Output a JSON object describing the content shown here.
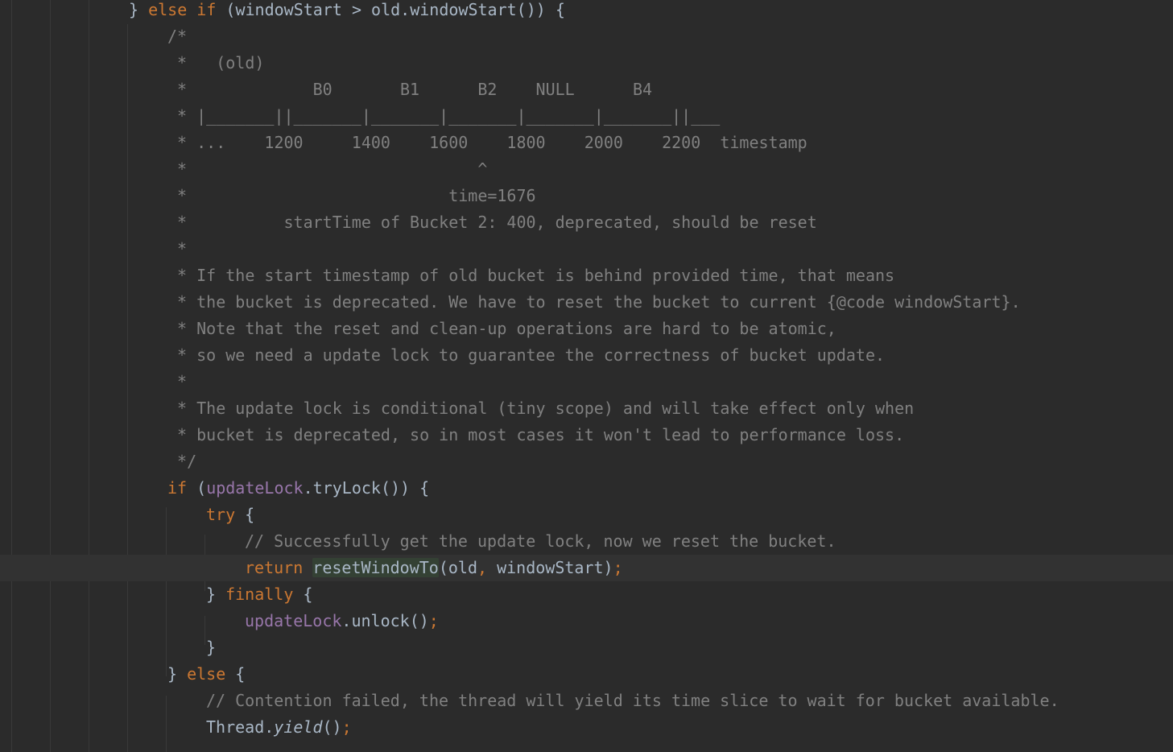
{
  "editor": {
    "line_height": 33,
    "colors": {
      "background": "#2b2b2b",
      "keyword": "#cc7832",
      "comment": "#808080",
      "field": "#9876aa",
      "text": "#a9b7c6",
      "current_line": "#323232",
      "identifier_highlight": "#344134"
    },
    "lines": [
      {
        "indent": 160,
        "tokens": [
          {
            "t": "} ",
            "c": "plain"
          },
          {
            "t": "else if",
            "c": "kw"
          },
          {
            "t": " (windowStart > old.windowStart()) {",
            "c": "plain"
          }
        ]
      },
      {
        "indent": 208,
        "tokens": [
          {
            "t": "/*",
            "c": "cm"
          }
        ]
      },
      {
        "indent": 208,
        "tokens": [
          {
            "t": " *   (old)",
            "c": "cm"
          }
        ]
      },
      {
        "indent": 208,
        "tokens": [
          {
            "t": " *             B0       B1      B2    NULL      B4",
            "c": "cm"
          }
        ]
      },
      {
        "indent": 208,
        "tokens": [
          {
            "t": " * |_______||_______|_______|_______|_______|_______||___",
            "c": "cm"
          }
        ]
      },
      {
        "indent": 208,
        "tokens": [
          {
            "t": " * ...    1200     1400    1600    1800    2000    2200  timestamp",
            "c": "cm"
          }
        ]
      },
      {
        "indent": 208,
        "tokens": [
          {
            "t": " *                              ^",
            "c": "cm"
          }
        ]
      },
      {
        "indent": 208,
        "tokens": [
          {
            "t": " *                           time=1676",
            "c": "cm"
          }
        ]
      },
      {
        "indent": 208,
        "tokens": [
          {
            "t": " *          startTime of Bucket 2: 400, deprecated, should be reset",
            "c": "cm"
          }
        ]
      },
      {
        "indent": 208,
        "tokens": [
          {
            "t": " *",
            "c": "cm"
          }
        ]
      },
      {
        "indent": 208,
        "tokens": [
          {
            "t": " * If the start timestamp of old bucket is behind provided time, that means",
            "c": "cm"
          }
        ]
      },
      {
        "indent": 208,
        "tokens": [
          {
            "t": " * the bucket is deprecated. We have to reset the bucket to current {@code windowStart}.",
            "c": "cm"
          }
        ]
      },
      {
        "indent": 208,
        "tokens": [
          {
            "t": " * Note that the reset and clean-up operations are hard to be atomic,",
            "c": "cm"
          }
        ]
      },
      {
        "indent": 208,
        "tokens": [
          {
            "t": " * so we need a update lock to guarantee the correctness of bucket update.",
            "c": "cm"
          }
        ]
      },
      {
        "indent": 208,
        "tokens": [
          {
            "t": " *",
            "c": "cm"
          }
        ]
      },
      {
        "indent": 208,
        "tokens": [
          {
            "t": " * The update lock is conditional (tiny scope) and will take effect only when",
            "c": "cm"
          }
        ]
      },
      {
        "indent": 208,
        "tokens": [
          {
            "t": " * bucket is deprecated, so in most cases it won't lead to performance loss.",
            "c": "cm"
          }
        ]
      },
      {
        "indent": 208,
        "tokens": [
          {
            "t": " */",
            "c": "cm"
          }
        ]
      },
      {
        "indent": 208,
        "tokens": [
          {
            "t": "if",
            "c": "kw"
          },
          {
            "t": " (",
            "c": "plain"
          },
          {
            "t": "updateLock",
            "c": "fld"
          },
          {
            "t": ".tryLock()) {",
            "c": "plain"
          }
        ]
      },
      {
        "indent": 256,
        "tokens": [
          {
            "t": "try",
            "c": "kw"
          },
          {
            "t": " {",
            "c": "plain"
          }
        ]
      },
      {
        "indent": 304,
        "tokens": [
          {
            "t": "// Successfully get the update lock, now we reset the bucket.",
            "c": "cm"
          }
        ]
      },
      {
        "indent": 304,
        "current": true,
        "tokens": [
          {
            "t": "return",
            "c": "kw"
          },
          {
            "t": " ",
            "c": "plain"
          },
          {
            "t": "resetWindowTo",
            "c": "plain hl-ident"
          },
          {
            "t": "(old",
            "c": "plain"
          },
          {
            "t": ",",
            "c": "kw"
          },
          {
            "t": " windowStart)",
            "c": "plain"
          },
          {
            "t": ";",
            "c": "kw"
          }
        ]
      },
      {
        "indent": 256,
        "tokens": [
          {
            "t": "} ",
            "c": "plain"
          },
          {
            "t": "finally",
            "c": "kw"
          },
          {
            "t": " {",
            "c": "plain"
          }
        ]
      },
      {
        "indent": 304,
        "tokens": [
          {
            "t": "updateLock",
            "c": "fld"
          },
          {
            "t": ".unlock()",
            "c": "plain"
          },
          {
            "t": ";",
            "c": "kw"
          }
        ]
      },
      {
        "indent": 256,
        "tokens": [
          {
            "t": "}",
            "c": "plain"
          }
        ]
      },
      {
        "indent": 208,
        "tokens": [
          {
            "t": "} ",
            "c": "plain"
          },
          {
            "t": "else",
            "c": "kw"
          },
          {
            "t": " {",
            "c": "plain"
          }
        ]
      },
      {
        "indent": 256,
        "tokens": [
          {
            "t": "// Contention failed, the thread will yield its time slice to wait for bucket available.",
            "c": "cm"
          }
        ]
      },
      {
        "indent": 256,
        "tokens": [
          {
            "t": "Thread.",
            "c": "plain"
          },
          {
            "t": "yield",
            "c": "plain italic"
          },
          {
            "t": "()",
            "c": "plain"
          },
          {
            "t": ";",
            "c": "kw"
          }
        ]
      }
    ]
  }
}
